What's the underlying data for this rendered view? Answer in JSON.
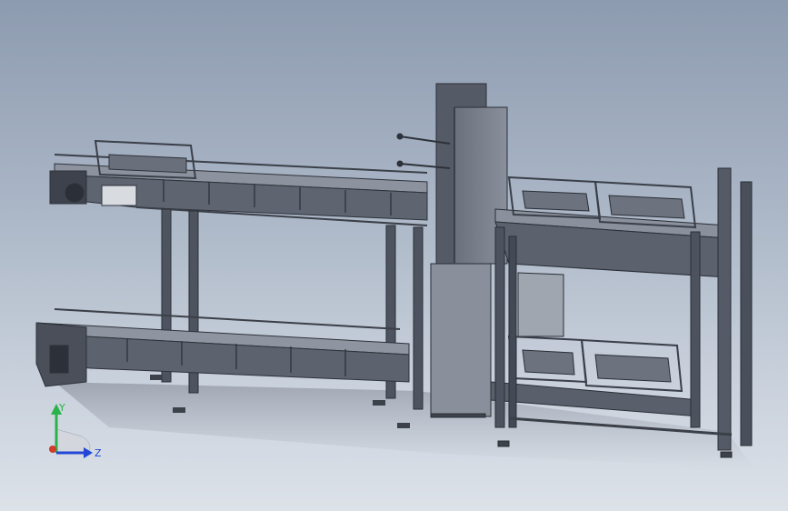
{
  "view": {
    "background_top": "#8d9bb0",
    "background_bottom": "#dde2e9",
    "model_color": "#5f6674",
    "model_dark": "#3a3f49",
    "model_light": "#9aa0ab"
  },
  "triad": {
    "x_label": "",
    "y_label": "Y",
    "z_label": "Z",
    "x_color": "#d23a2a",
    "y_color": "#2bb24c",
    "z_color": "#2246d6"
  }
}
